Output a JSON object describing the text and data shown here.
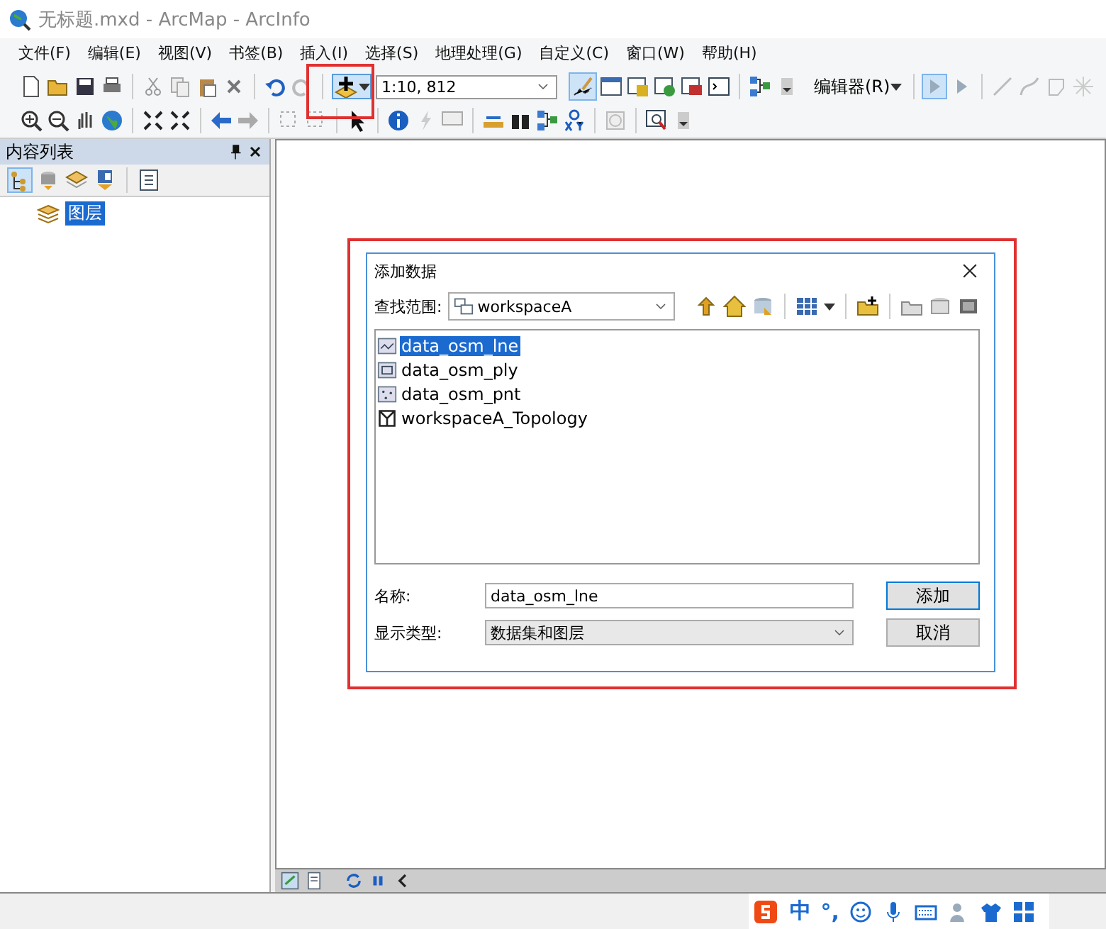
{
  "window": {
    "title": "无标题.mxd - ArcMap - ArcInfo"
  },
  "menu": [
    "文件(F)",
    "编辑(E)",
    "视图(V)",
    "书签(B)",
    "插入(I)",
    "选择(S)",
    "地理处理(G)",
    "自定义(C)",
    "窗口(W)",
    "帮助(H)"
  ],
  "toolbar": {
    "scale": "1:10, 812",
    "editor": "编辑器(R)"
  },
  "toc": {
    "title": "内容列表",
    "layers": [
      {
        "label": "图层",
        "selected": true
      }
    ]
  },
  "dialog": {
    "title": "添加数据",
    "look_in_label": "查找范围:",
    "look_in": "workspaceA",
    "items": [
      {
        "kind": "line",
        "label": "data_osm_lne",
        "selected": true
      },
      {
        "kind": "polygon",
        "label": "data_osm_ply",
        "selected": false
      },
      {
        "kind": "point",
        "label": "data_osm_pnt",
        "selected": false
      },
      {
        "kind": "topology",
        "label": "workspaceA_Topology",
        "selected": false
      }
    ],
    "name_label": "名称:",
    "name_value": "data_osm_lne",
    "type_label": "显示类型:",
    "type_value": "数据集和图层",
    "buttons": [
      "添加",
      "取消"
    ]
  },
  "ime": {
    "mode": "中",
    "punct": "°,"
  }
}
